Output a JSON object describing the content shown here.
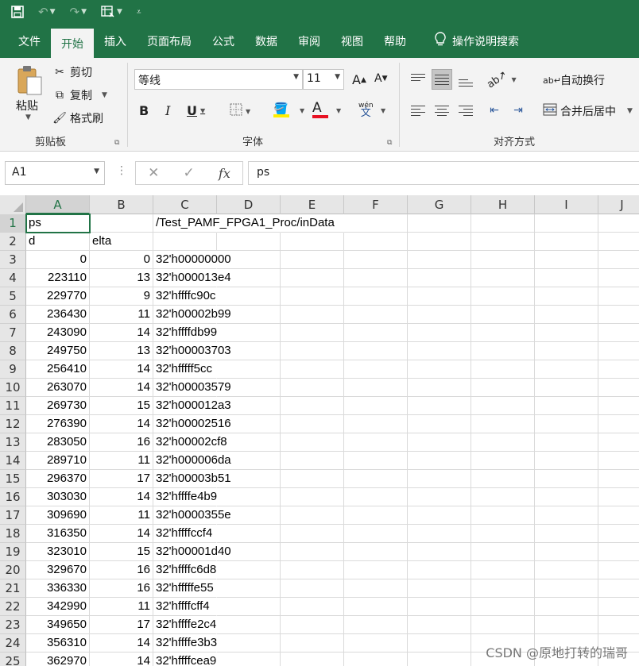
{
  "qat": {
    "save_icon": "save-icon",
    "undo_icon": "undo-icon",
    "redo_icon": "redo-icon",
    "form_icon": "form-icon"
  },
  "tabs": [
    {
      "label": "文件"
    },
    {
      "label": "开始"
    },
    {
      "label": "插入"
    },
    {
      "label": "页面布局"
    },
    {
      "label": "公式"
    },
    {
      "label": "数据"
    },
    {
      "label": "审阅"
    },
    {
      "label": "视图"
    },
    {
      "label": "帮助"
    },
    {
      "label": "操作说明搜索"
    }
  ],
  "ribbon": {
    "clipboard": {
      "paste": "粘贴",
      "cut": "剪切",
      "copy": "复制",
      "format_painter": "格式刷",
      "label": "剪贴板"
    },
    "font": {
      "name": "等线",
      "size": "11",
      "grow": "A",
      "shrink": "A",
      "bold": "B",
      "italic": "I",
      "underline": "U",
      "font_color_letter": "A",
      "phonetic_top": "wén",
      "phonetic_bottom": "文",
      "label": "字体"
    },
    "alignment": {
      "wrap_text": "自动换行",
      "merge_center": "合并后居中",
      "label": "对齐方式"
    }
  },
  "formula_bar": {
    "name_box": "A1",
    "fx": "fx",
    "content": "ps"
  },
  "columns": [
    "A",
    "B",
    "C",
    "D",
    "E",
    "F",
    "G",
    "H",
    "I",
    "J"
  ],
  "rows": [
    {
      "n": "1",
      "a": "ps",
      "b": "",
      "c": "/Test_PAMF_FPGA1_Proc/inData"
    },
    {
      "n": "2",
      "a": "d",
      "b": "elta",
      "c": ""
    },
    {
      "n": "3",
      "a": "0",
      "b": "0",
      "c": "32'h00000000"
    },
    {
      "n": "4",
      "a": "223110",
      "b": "13",
      "c": "32'h000013e4"
    },
    {
      "n": "5",
      "a": "229770",
      "b": "9",
      "c": "32'hffffc90c"
    },
    {
      "n": "6",
      "a": "236430",
      "b": "11",
      "c": "32'h00002b99"
    },
    {
      "n": "7",
      "a": "243090",
      "b": "14",
      "c": "32'hffffdb99"
    },
    {
      "n": "8",
      "a": "249750",
      "b": "13",
      "c": "32'h00003703"
    },
    {
      "n": "9",
      "a": "256410",
      "b": "14",
      "c": "32'hfffff5cc"
    },
    {
      "n": "10",
      "a": "263070",
      "b": "14",
      "c": "32'h00003579"
    },
    {
      "n": "11",
      "a": "269730",
      "b": "15",
      "c": "32'h000012a3"
    },
    {
      "n": "12",
      "a": "276390",
      "b": "14",
      "c": "32'h00002516"
    },
    {
      "n": "13",
      "a": "283050",
      "b": "16",
      "c": "32'h00002cf8"
    },
    {
      "n": "14",
      "a": "289710",
      "b": "11",
      "c": "32'h000006da"
    },
    {
      "n": "15",
      "a": "296370",
      "b": "17",
      "c": "32'h00003b51"
    },
    {
      "n": "16",
      "a": "303030",
      "b": "14",
      "c": "32'hffffe4b9"
    },
    {
      "n": "17",
      "a": "309690",
      "b": "11",
      "c": "32'h0000355e"
    },
    {
      "n": "18",
      "a": "316350",
      "b": "14",
      "c": "32'hffffccf4"
    },
    {
      "n": "19",
      "a": "323010",
      "b": "15",
      "c": "32'h00001d40"
    },
    {
      "n": "20",
      "a": "329670",
      "b": "16",
      "c": "32'hffffc6d8"
    },
    {
      "n": "21",
      "a": "336330",
      "b": "16",
      "c": "32'hfffffe55"
    },
    {
      "n": "22",
      "a": "342990",
      "b": "11",
      "c": "32'hffffcff4"
    },
    {
      "n": "23",
      "a": "349650",
      "b": "17",
      "c": "32'hffffe2c4"
    },
    {
      "n": "24",
      "a": "356310",
      "b": "14",
      "c": "32'hffffe3b3"
    },
    {
      "n": "25",
      "a": "362970",
      "b": "14",
      "c": "32'hffffcea9"
    }
  ],
  "watermark": "CSDN @原地打转的瑞哥",
  "colors": {
    "accent": "#217346",
    "font_color_bar": "#e81123",
    "fill_color_bar": "#ffee00"
  }
}
